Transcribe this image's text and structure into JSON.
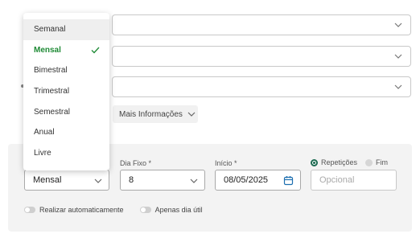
{
  "dropdown": {
    "options": [
      {
        "label": "Semanal"
      },
      {
        "label": "Mensal"
      },
      {
        "label": "Bimestral"
      },
      {
        "label": "Trimestral"
      },
      {
        "label": "Semestral"
      },
      {
        "label": "Anual"
      },
      {
        "label": "Livre"
      }
    ],
    "selected": "Mensal"
  },
  "mais_informacoes": {
    "label": "Mais Informações"
  },
  "schedule": {
    "frequencia_value": "Mensal",
    "dia_fixo_label": "Dia Fixo *",
    "dia_fixo_value": "8",
    "inicio_label": "Início *",
    "inicio_value": "08/05/2025",
    "repeticoes_label": "Repetições",
    "fim_label": "Fim",
    "repeticoes_placeholder": "Opcional"
  },
  "toggles": {
    "realizar_label": "Realizar automaticamente",
    "apenas_label": "Apenas dia útil"
  },
  "colors": {
    "accent_green": "#1e8a35",
    "radio_green": "#1d6b52",
    "panel_bg": "#f3f3f3"
  }
}
